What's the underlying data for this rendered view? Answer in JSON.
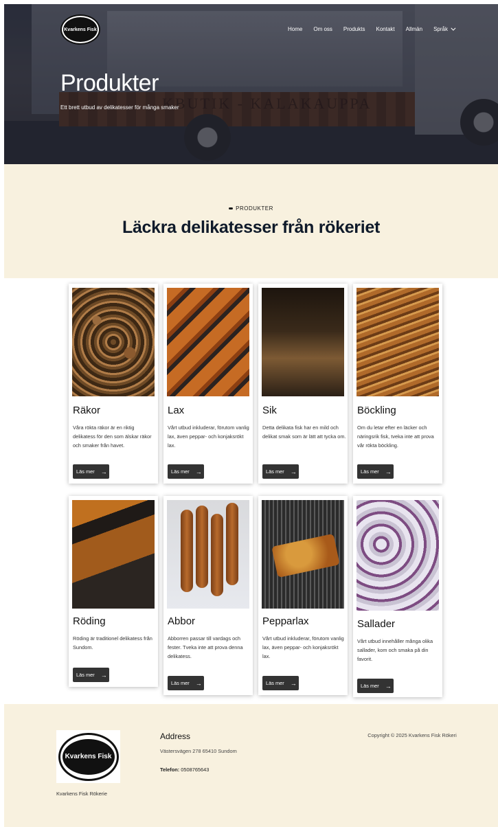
{
  "header": {
    "logo_text": "Kvarkens Fisk",
    "nav": [
      "Home",
      "Om oss",
      "Produkts",
      "Kontakt",
      "Allmän",
      "Språk"
    ],
    "title": "Produkter",
    "subtitle": "Ett brett utbud av delikatesser för många smaker",
    "truck_text": "KBUTIK - KALAKAUPPA"
  },
  "intro": {
    "eyebrow": "PRODUKTER",
    "title": "Läckra delikatesser från rökeriet"
  },
  "products": [
    {
      "name": "Räkor",
      "desc": "Våra rökta räkor är en riktig delikatess för den som älskar räkor och smaker från havet.",
      "button": "Läs mer"
    },
    {
      "name": "Lax",
      "desc": "Vårt utbud inkluderar, förutom vanlig lax, även peppar- och konjaksrökt lax.",
      "button": "Läs mer"
    },
    {
      "name": "Sik",
      "desc": "Detta delikata fisk har en mild och delikat smak som är lätt att tycka om.",
      "button": "Läs mer"
    },
    {
      "name": "Böckling",
      "desc": "Om du letar efter en läcker och näringsrik fisk, tveka inte att prova vår rökta böckling.",
      "button": "Läs mer"
    },
    {
      "name": "Röding",
      "desc": "Röding är traditionel delikatess från Sundom.",
      "button": "Läs mer"
    },
    {
      "name": "Abbor",
      "desc": "Abborren passar till vardags och fester. Tveka inte att prova denna delikatess.",
      "button": "Läs mer"
    },
    {
      "name": "Pepparlax",
      "desc": "Vårt utbud inkluderar, förutom vanlig lax, även peppar- och konjaksrökt lax.",
      "button": "Läs mer"
    },
    {
      "name": "Sallader",
      "desc": "Vårt utbud innehåller många olika sallader, kom och smaka på din favorit.",
      "button": "Läs mer"
    }
  ],
  "footer": {
    "logo_caption": "Kvarkens Fisk Rökerie",
    "address_heading": "Address",
    "address": "Västersvägen 278 65410 Sundom",
    "telefon_label": "Telefon:",
    "telefon": "0508765643",
    "copyright": "Copyright © 2025 Kvarkens Fisk Rökeri"
  },
  "colors": {
    "cream": "#f8f1df",
    "button": "#333333",
    "heading": "#0f1a2a"
  }
}
